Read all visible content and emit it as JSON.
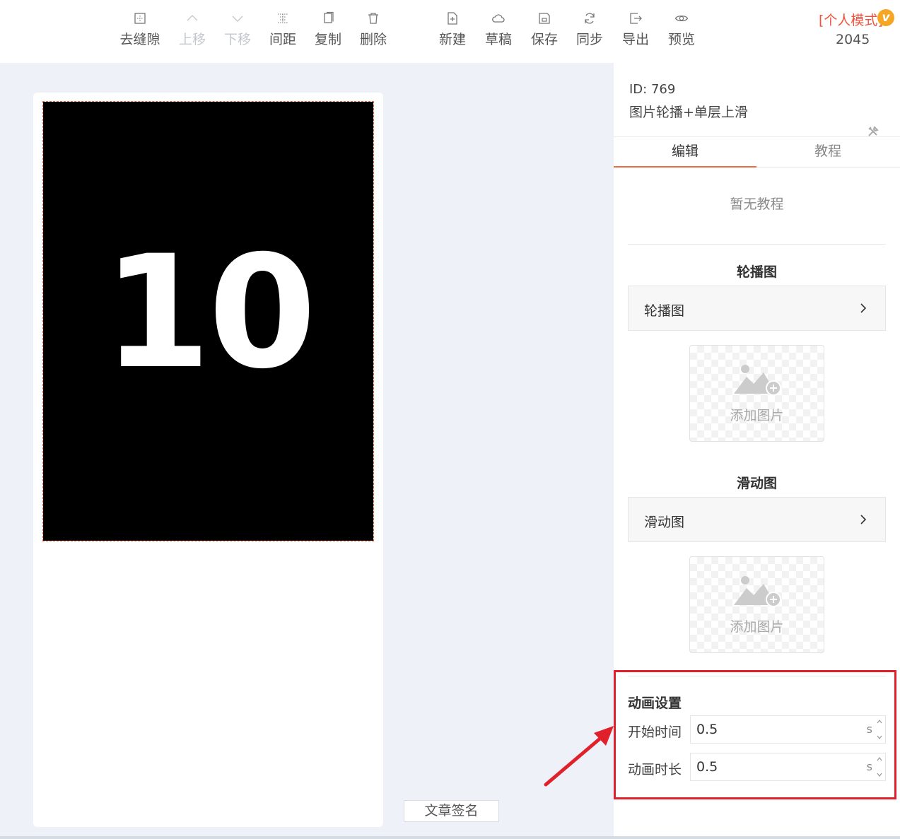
{
  "toolbar": {
    "items": [
      {
        "label": "去缝隙",
        "icon": "gap-remove-icon",
        "disabled": false
      },
      {
        "label": "上移",
        "icon": "chevron-up-icon",
        "disabled": true
      },
      {
        "label": "下移",
        "icon": "chevron-down-icon",
        "disabled": true
      },
      {
        "label": "间距",
        "icon": "spacing-icon",
        "disabled": false
      },
      {
        "label": "复制",
        "icon": "copy-icon",
        "disabled": false
      },
      {
        "label": "删除",
        "icon": "trash-icon",
        "disabled": false
      },
      {
        "label": "新建",
        "icon": "new-file-icon",
        "disabled": false
      },
      {
        "label": "草稿",
        "icon": "cloud-icon",
        "disabled": false
      },
      {
        "label": "保存",
        "icon": "save-icon",
        "disabled": false
      },
      {
        "label": "同步",
        "icon": "sync-icon",
        "disabled": false
      },
      {
        "label": "导出",
        "icon": "export-icon",
        "disabled": false
      },
      {
        "label": "预览",
        "icon": "eye-icon",
        "disabled": false
      }
    ],
    "mode_label": "[个人模式]",
    "vip_badge": "v",
    "count": "2045"
  },
  "canvas": {
    "slide_text": "10",
    "sign_button": "文章签名"
  },
  "panel": {
    "id_label": "ID: 769",
    "template_name": "图片轮播+单层上滑",
    "tabs": [
      "编辑",
      "教程"
    ],
    "active_tab": "编辑",
    "no_tutorial": "暂无教程",
    "carousel": {
      "section_title": "轮播图",
      "row_label": "轮播图",
      "add_image_label": "添加图片"
    },
    "slide": {
      "section_title": "滑动图",
      "row_label": "滑动图",
      "add_image_label": "添加图片"
    },
    "animation": {
      "title": "动画设置",
      "start_label": "开始时间",
      "start_value": "0.5",
      "duration_label": "动画时长",
      "duration_value": "0.5",
      "unit": "s"
    }
  },
  "colors": {
    "accent": "#ef6a3f",
    "mode_text": "#f0523d",
    "highlight": "#e0202b",
    "canvas_bg": "#eef1f8"
  }
}
